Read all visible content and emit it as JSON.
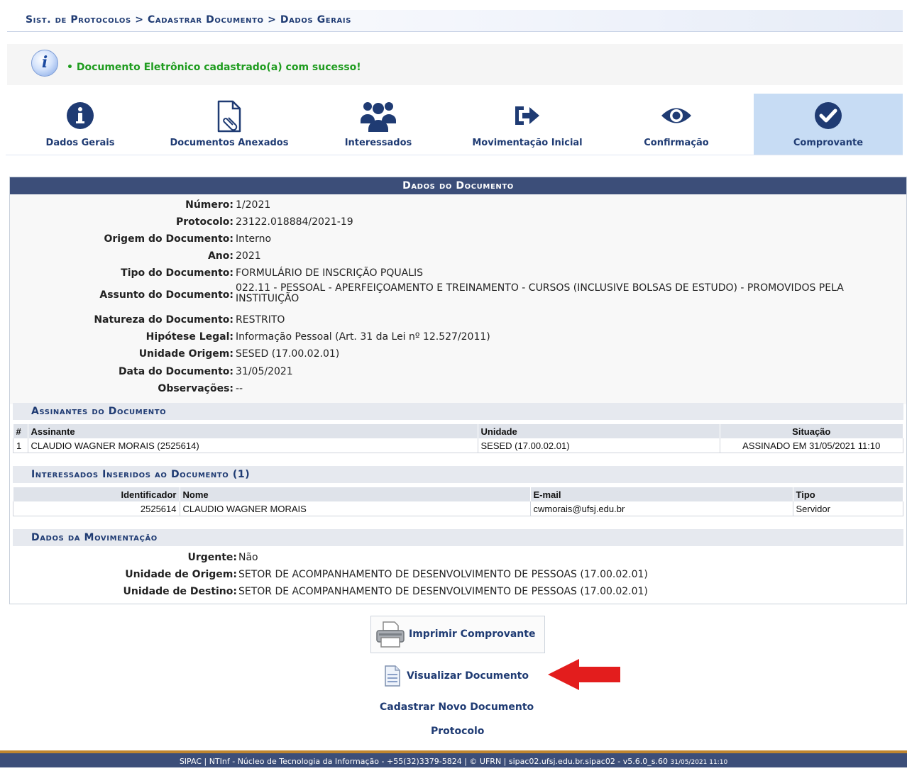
{
  "breadcrumb": "Sist. de Protocolos > Cadastrar Documento > Dados Gerais",
  "message": "Documento Eletrônico cadastrado(a) com sucesso!",
  "wizard": {
    "steps": [
      {
        "label": "Dados Gerais",
        "icon": "info-circle-icon"
      },
      {
        "label": "Documentos Anexados",
        "icon": "document-attachment-icon"
      },
      {
        "label": "Interessados",
        "icon": "users-icon"
      },
      {
        "label": "Movimentação Inicial",
        "icon": "sign-in-icon"
      },
      {
        "label": "Confirmação",
        "icon": "eye-icon"
      },
      {
        "label": "Comprovante",
        "icon": "check-circle-icon"
      }
    ],
    "active": "Comprovante"
  },
  "panel_title": "Dados do Documento",
  "fields": [
    {
      "label": "Número:",
      "value": "1/2021"
    },
    {
      "label": "Protocolo:",
      "value": "23122.018884/2021-19"
    },
    {
      "label": "Origem do Documento:",
      "value": "Interno"
    },
    {
      "label": "Ano:",
      "value": "2021"
    },
    {
      "label": "Tipo do Documento:",
      "value": "FORMULÁRIO DE INSCRIÇÃO PQUALIS"
    },
    {
      "label": "Assunto do Documento:",
      "value": "022.11 - PESSOAL - APERFEIÇOAMENTO E TREINAMENTO - CURSOS (INCLUSIVE BOLSAS DE ESTUDO) - PROMOVIDOS PELA INSTITUIÇÃO"
    },
    {
      "label": "Natureza do Documento:",
      "value": "RESTRITO"
    },
    {
      "label": "Hipótese Legal:",
      "value": "Informação Pessoal (Art. 31 da Lei nº 12.527/2011)"
    },
    {
      "label": "Unidade Origem:",
      "value": "SESED (17.00.02.01)"
    },
    {
      "label": "Data do Documento:",
      "value": "31/05/2021"
    },
    {
      "label": "Observações:",
      "value": "--"
    }
  ],
  "signers": {
    "title": "Assinantes do Documento",
    "headers": [
      "#",
      "Assinante",
      "Unidade",
      "Situação"
    ],
    "rows": [
      [
        "1",
        "CLAUDIO WAGNER MORAIS (2525614)",
        "SESED (17.00.02.01)",
        "ASSINADO EM 31/05/2021 11:10"
      ]
    ],
    "status_color": "#1a8a1a"
  },
  "interested": {
    "title": "Interessados Inseridos ao Documento (1)",
    "headers": [
      "Identificador",
      "Nome",
      "E-mail",
      "Tipo"
    ],
    "rows": [
      [
        "2525614",
        "CLAUDIO WAGNER MORAIS",
        "cwmorais@ufsj.edu.br",
        "Servidor"
      ]
    ]
  },
  "movement": {
    "title": "Dados da Movimentação",
    "fields": [
      {
        "label": "Urgente:",
        "value": "Não"
      },
      {
        "label": "Unidade de Origem:",
        "value": "SETOR DE ACOMPANHAMENTO DE DESENVOLVIMENTO DE PESSOAS (17.00.02.01)"
      },
      {
        "label": "Unidade de Destino:",
        "value": "SETOR DE ACOMPANHAMENTO DE DESENVOLVIMENTO DE PESSOAS (17.00.02.01)"
      }
    ]
  },
  "actions": {
    "print": "Imprimir Comprovante",
    "view": "Visualizar Documento",
    "new": "Cadastrar Novo Documento",
    "protocol": "Protocolo"
  },
  "footer": {
    "text": "SIPAC | NTInf - Núcleo de Tecnologia da Informação - +55(32)3379-5824 | © UFRN | sipac02.ufsj.edu.br.sipac02 - v5.6.0_s.60",
    "timestamp": "31/05/2021 11:10"
  },
  "colors": {
    "header_bg": "#3c4e79",
    "link": "#1f3b73",
    "success": "#1f9c1f",
    "arrow": "#e31d1d",
    "active_step": "#c7dcf4"
  }
}
